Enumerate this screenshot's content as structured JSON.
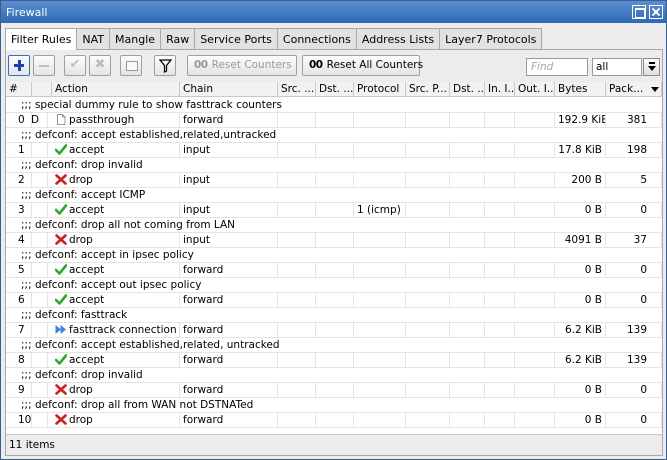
{
  "window": {
    "title": "Firewall"
  },
  "tabs": [
    "Filter Rules",
    "NAT",
    "Mangle",
    "Raw",
    "Service Ports",
    "Connections",
    "Address Lists",
    "Layer7 Protocols"
  ],
  "toolbar": {
    "reset_counters": "Reset Counters",
    "reset_all_counters": "Reset All Counters",
    "counter_glyph": "00",
    "find_placeholder": "Find",
    "filter_value": "all"
  },
  "columns": [
    "#",
    "",
    "Action",
    "Chain",
    "Src. ...",
    "Dst. ...",
    "Protocol",
    "Src. P...",
    "Dst. ...",
    "In. I...",
    "Out. I...",
    "Bytes",
    "Pack..."
  ],
  "rules": [
    {
      "comment": ";;; special dummy rule to show fasttrack counters",
      "num": "0",
      "flag": "D",
      "action": "passthrough",
      "icon": "page-icon",
      "chain": "forward",
      "protocol": "",
      "bytes": "192.9 KiB",
      "packets": "381"
    },
    {
      "comment": ";;; defconf: accept established,related,untracked",
      "num": "1",
      "flag": "",
      "action": "accept",
      "icon": "check-icon",
      "chain": "input",
      "protocol": "",
      "bytes": "17.8 KiB",
      "packets": "198"
    },
    {
      "comment": ";;; defconf: drop invalid",
      "num": "2",
      "flag": "",
      "action": "drop",
      "icon": "x-icon",
      "chain": "input",
      "protocol": "",
      "bytes": "200 B",
      "packets": "5"
    },
    {
      "comment": ";;; defconf: accept ICMP",
      "num": "3",
      "flag": "",
      "action": "accept",
      "icon": "check-icon",
      "chain": "input",
      "protocol": "1 (icmp)",
      "bytes": "0 B",
      "packets": "0"
    },
    {
      "comment": ";;; defconf: drop all not coming from LAN",
      "num": "4",
      "flag": "",
      "action": "drop",
      "icon": "x-icon",
      "chain": "input",
      "protocol": "",
      "bytes": "4091 B",
      "packets": "37"
    },
    {
      "comment": ";;; defconf: accept in ipsec policy",
      "num": "5",
      "flag": "",
      "action": "accept",
      "icon": "check-icon",
      "chain": "forward",
      "protocol": "",
      "bytes": "0 B",
      "packets": "0"
    },
    {
      "comment": ";;; defconf: accept out ipsec policy",
      "num": "6",
      "flag": "",
      "action": "accept",
      "icon": "check-icon",
      "chain": "forward",
      "protocol": "",
      "bytes": "0 B",
      "packets": "0"
    },
    {
      "comment": ";;; defconf: fasttrack",
      "num": "7",
      "flag": "",
      "action": "fasttrack connection",
      "icon": "fast-forward-icon",
      "chain": "forward",
      "protocol": "",
      "bytes": "6.2 KiB",
      "packets": "139"
    },
    {
      "comment": ";;; defconf: accept established,related, untracked",
      "num": "8",
      "flag": "",
      "action": "accept",
      "icon": "check-icon",
      "chain": "forward",
      "protocol": "",
      "bytes": "6.2 KiB",
      "packets": "139"
    },
    {
      "comment": ";;; defconf: drop invalid",
      "num": "9",
      "flag": "",
      "action": "drop",
      "icon": "x-icon",
      "chain": "forward",
      "protocol": "",
      "bytes": "0 B",
      "packets": "0"
    },
    {
      "comment": ";;; defconf:  drop all from WAN not DSTNATed",
      "num": "10",
      "flag": "",
      "action": "drop",
      "icon": "x-icon",
      "chain": "forward",
      "protocol": "",
      "bytes": "0 B",
      "packets": "0"
    }
  ],
  "status": {
    "items": "11 items"
  }
}
